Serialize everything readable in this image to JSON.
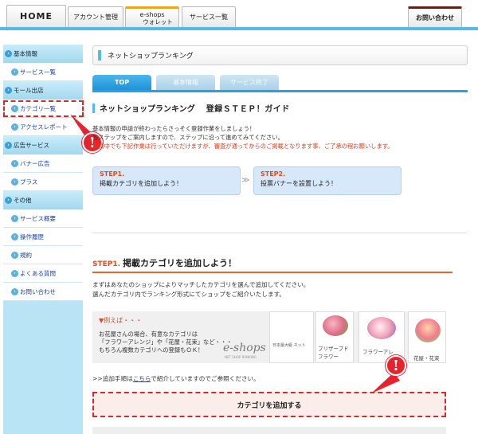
{
  "topnav": {
    "home": "HOME",
    "account": "アカウント管理",
    "eshops_line1": "e-shops",
    "eshops_line2": "ウォレット",
    "services": "サービス一覧",
    "contact": "お問い合わせ"
  },
  "sidebar": {
    "items": [
      {
        "label": "基本情報",
        "kind": "head"
      },
      {
        "label": "サービス一覧",
        "kind": "sub"
      },
      {
        "label": "モール出店",
        "kind": "head"
      },
      {
        "label": "カテゴリ一覧",
        "kind": "sub"
      },
      {
        "label": "アクセスレポート",
        "kind": "sub"
      },
      {
        "label": "広告サービス",
        "kind": "head"
      },
      {
        "label": "バナー広告",
        "kind": "sub"
      },
      {
        "label": "プラス",
        "kind": "sub"
      },
      {
        "label": "その他",
        "kind": "head"
      },
      {
        "label": "サービス概要",
        "kind": "sub"
      },
      {
        "label": "操作履歴",
        "kind": "sub"
      },
      {
        "label": "規約",
        "kind": "sub"
      },
      {
        "label": "よくある質問",
        "kind": "sub"
      },
      {
        "label": "お問い合わせ",
        "kind": "sub"
      }
    ]
  },
  "main": {
    "title": "ネットショップランキング",
    "tabs": [
      "TOP",
      "基本情報",
      "サービス終了"
    ],
    "guide_title_1": "ネットショップランキング",
    "guide_title_2": "登録ＳＴＥＰ！ガイド",
    "intro_1": "基本情報の申請が終わったらさっそく登録作業をしましょう！",
    "intro_2": "各ステップをご案内しますので、ステップに沿って進めてみてください。",
    "intro_3": "申請中でも下記作業は行っていただけますが、審査が通ってからのご掲載となります事、ご了承の程お願いします。",
    "steps": [
      {
        "label": "STEP1.",
        "text": "掲載カテゴリを追加しよう！"
      },
      {
        "label": "STEP2.",
        "text": "投票バナーを設置しよう！"
      }
    ],
    "step_arrow": "≫",
    "step1_heading_num": "STEP1.",
    "step1_heading": "掲載カテゴリを追加しよう！",
    "desc_1": "まずはあなたのショップによりマッチしたカテゴリを選んで追加してください。",
    "desc_2": "選んだカテゴリ内でランキング形式にてショップをご紹介いたします。",
    "example_heading": "▼例えば・・・",
    "example_1": "お花屋さんの場合、有意なカテゴリは",
    "example_2": "「フラワーアレンジ」や「花屋・花束」など・・・",
    "example_3": "もちろん複数カテゴリへの登録もＯＫ！",
    "logo_text": "e-shops",
    "logo_tag": "NET SHOP RANKING",
    "sample_caption_1": "プリザーブドフラワー",
    "sample_caption_2": "フラワーアレ",
    "sample_caption_3": "花屋・花束",
    "sample_header": "日本最大級 ネット",
    "howto_prefix": ">>追加手順は",
    "howto_link": "こちら",
    "howto_suffix": "で紹介していますのでご参照ください。",
    "add_button": "カテゴリを追加する",
    "alert_mark": "!"
  },
  "colors": {
    "accent_blue": "#2e9ee0",
    "alert_red": "#e8222d",
    "step_orange": "#e04c1e"
  }
}
